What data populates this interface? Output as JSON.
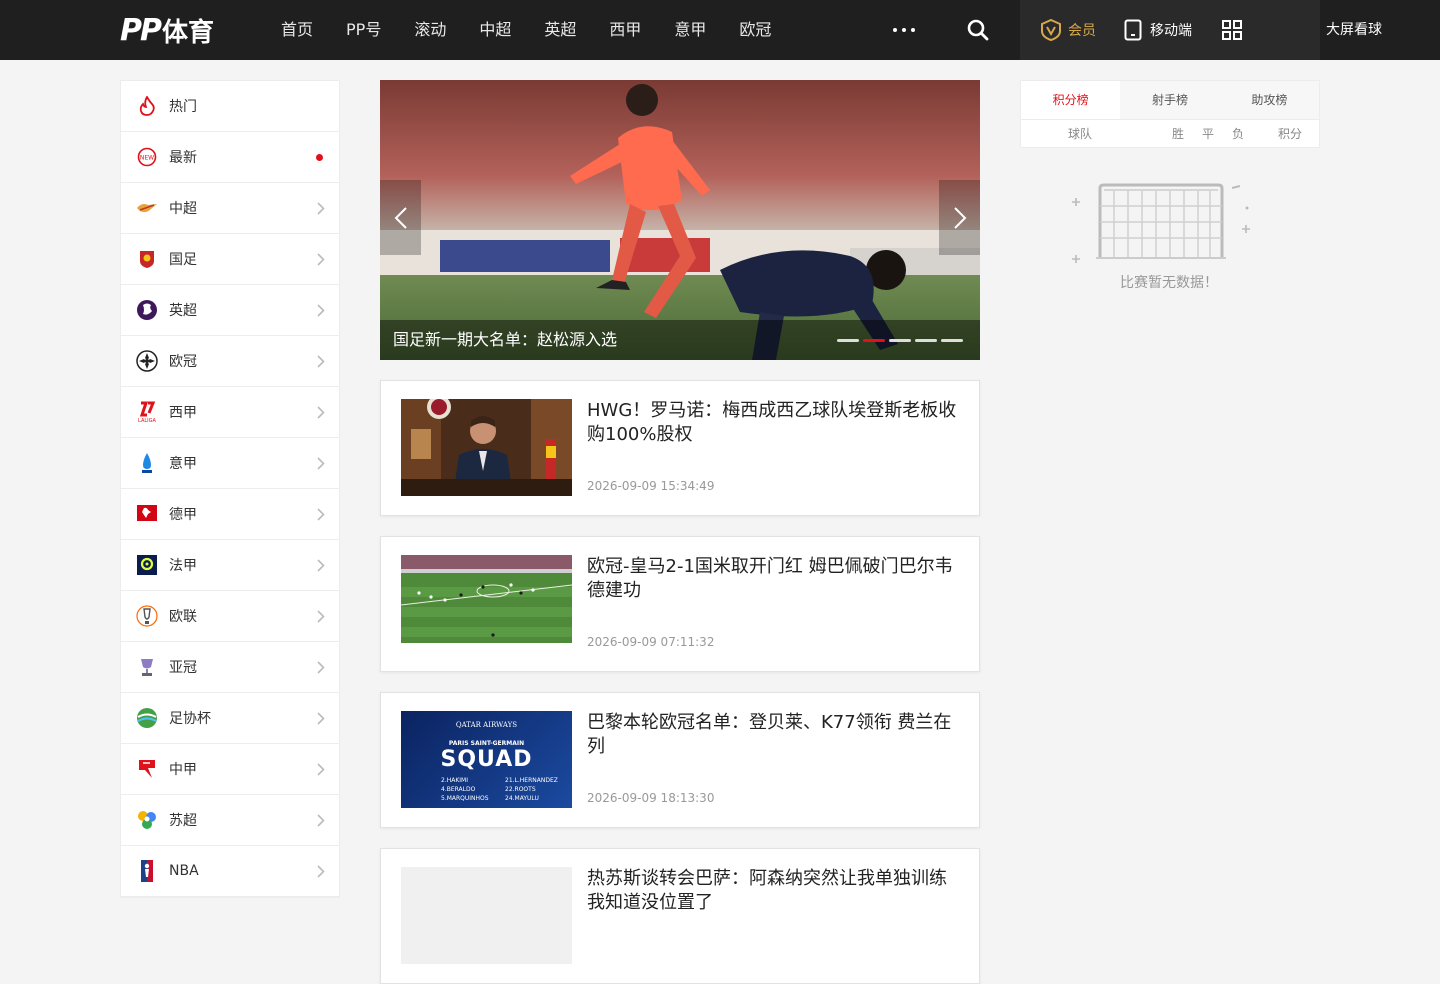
{
  "header": {
    "logo": "PP体育",
    "nav": [
      "首页",
      "PP号",
      "滚动",
      "中超",
      "英超",
      "西甲",
      "意甲",
      "欧冠"
    ],
    "vip_label": "会员",
    "mobile_label": "移动端",
    "bigscreen_label": "大屏看球"
  },
  "sidebar": {
    "items": [
      {
        "label": "热门",
        "icon": "fire-icon"
      },
      {
        "label": "最新",
        "icon": "new-badge-icon"
      },
      {
        "label": "中超",
        "icon": "csl-logo-icon"
      },
      {
        "label": "国足",
        "icon": "china-team-icon"
      },
      {
        "label": "英超",
        "icon": "premier-league-icon"
      },
      {
        "label": "欧冠",
        "icon": "champions-league-icon"
      },
      {
        "label": "西甲",
        "icon": "laliga-icon"
      },
      {
        "label": "意甲",
        "icon": "serie-a-icon"
      },
      {
        "label": "德甲",
        "icon": "bundesliga-icon"
      },
      {
        "label": "法甲",
        "icon": "ligue1-icon"
      },
      {
        "label": "欧联",
        "icon": "europa-league-icon"
      },
      {
        "label": "亚冠",
        "icon": "afc-trophy-icon"
      },
      {
        "label": "足协杯",
        "icon": "fa-cup-icon"
      },
      {
        "label": "中甲",
        "icon": "china-league-one-icon"
      },
      {
        "label": "苏超",
        "icon": "suchao-icon"
      },
      {
        "label": "NBA",
        "icon": "nba-icon"
      }
    ]
  },
  "banner": {
    "title": "国足新一期大名单：赵松源入选",
    "slide_count": 5,
    "active_slide": 2
  },
  "news": [
    {
      "title": "HWG！罗马诺：梅西成西乙球队埃登斯老板收购100%股权",
      "time": "2026-09-09 15:34:49"
    },
    {
      "title": "欧冠-皇马2-1国米取开门红 姆巴佩破门巴尔韦德建功",
      "time": "2026-09-09 07:11:32"
    },
    {
      "title": "巴黎本轮欧冠名单：登贝莱、K77领衔 费兰在列",
      "time": "2026-09-09 18:13:30"
    },
    {
      "title": "热苏斯谈转会巴萨：阿森纳突然让我单独训练我知道没位置了",
      "time": ""
    }
  ],
  "thumb_text": {
    "sponsor": "QATAR AIRWAYS",
    "club": "PARIS SAINT-GERMAIN",
    "squad": "SQUAD",
    "players": [
      "2.HAKIMI",
      "4.BERALDO",
      "5.MARQUINHOS",
      "21.L.HERNANDEZ",
      "22.ROOTS",
      "24.MAYULU"
    ]
  },
  "rank": {
    "tabs": [
      "积分榜",
      "射手榜",
      "助攻榜"
    ],
    "active_tab": 0,
    "columns": [
      "球队",
      "胜",
      "平",
      "负",
      "积分"
    ],
    "empty_text": "比赛暂无数据！"
  },
  "colors": {
    "accent": "#e0111a",
    "header_bg": "#1f1f1f",
    "vip_gold": "#d7a84b"
  }
}
